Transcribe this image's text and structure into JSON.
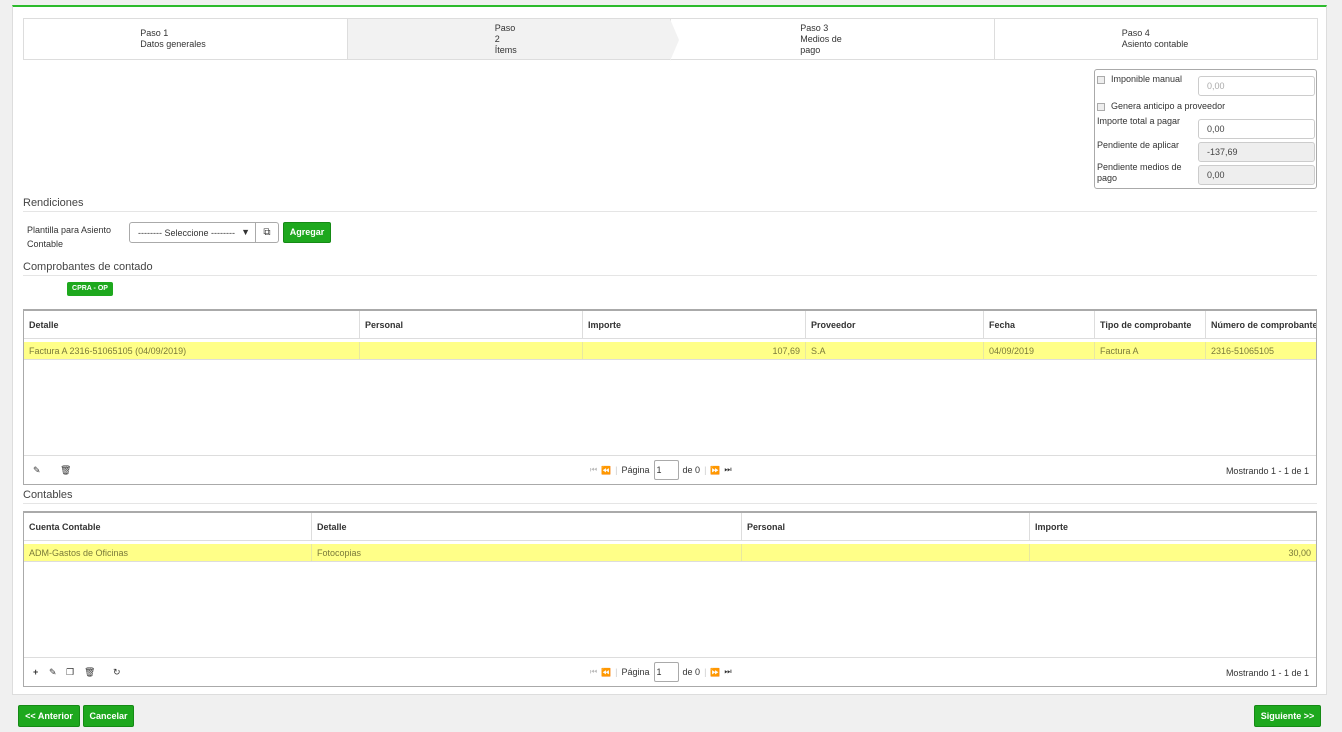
{
  "wizard": {
    "steps": [
      {
        "step": "Paso 1",
        "name": "Datos generales"
      },
      {
        "step": "Paso 2",
        "name": "Ítems"
      },
      {
        "step": "Paso 3",
        "name": "Medios de pago"
      },
      {
        "step": "Paso 4",
        "name": "Asiento contable"
      }
    ],
    "active_step": 2
  },
  "summary": {
    "imponible_manual_label": "Imponible manual",
    "imponible_manual_value": "0,00",
    "genera_anticipo_label": "Genera anticipo a proveedor",
    "importe_total_label": "Importe total a pagar",
    "importe_total_value": "0,00",
    "pendiente_aplicar_label": "Pendiente de aplicar",
    "pendiente_aplicar_value": "-137,69",
    "pendiente_medios_label": "Pendiente medios de pago",
    "pendiente_medios_value": "0,00"
  },
  "rendiciones": {
    "heading": "Rendiciones",
    "plantilla_label": "Plantilla para Asiento Contable",
    "select_value": "-------- Seleccione --------",
    "agregar_label": "Agregar"
  },
  "comprobantes": {
    "heading": "Comprobantes de contado",
    "badge": "CPRA - OP",
    "columns": [
      "Detalle",
      "Personal",
      "Importe",
      "Proveedor",
      "Fecha",
      "Tipo de comprobante",
      "Número de comprobante"
    ],
    "rows": [
      [
        "Factura A 2316-51065105 (04/09/2019)",
        "",
        "107,69",
        "S.A",
        "04/09/2019",
        "Factura A",
        "2316-51065105"
      ]
    ],
    "page_label": "Página",
    "page_value": "1",
    "of_label": "de 0",
    "showing": "Mostrando 1 - 1 de 1"
  },
  "contables": {
    "heading": "Contables",
    "columns": [
      "Cuenta Contable",
      "Detalle",
      "Personal",
      "Importe"
    ],
    "rows": [
      [
        "ADM-Gastos de Oficinas",
        "Fotocopias",
        "",
        "30,00"
      ]
    ],
    "page_label": "Página",
    "page_value": "1",
    "of_label": "de 0",
    "showing": "Mostrando 1 - 1 de 1"
  },
  "footer": {
    "anterior_label": "<< Anterior",
    "cancelar_label": "Cancelar",
    "siguiente_label": "Siguiente >>"
  },
  "colors": {
    "accent": "#1ea81e",
    "row_highlight": "#ffff88"
  }
}
